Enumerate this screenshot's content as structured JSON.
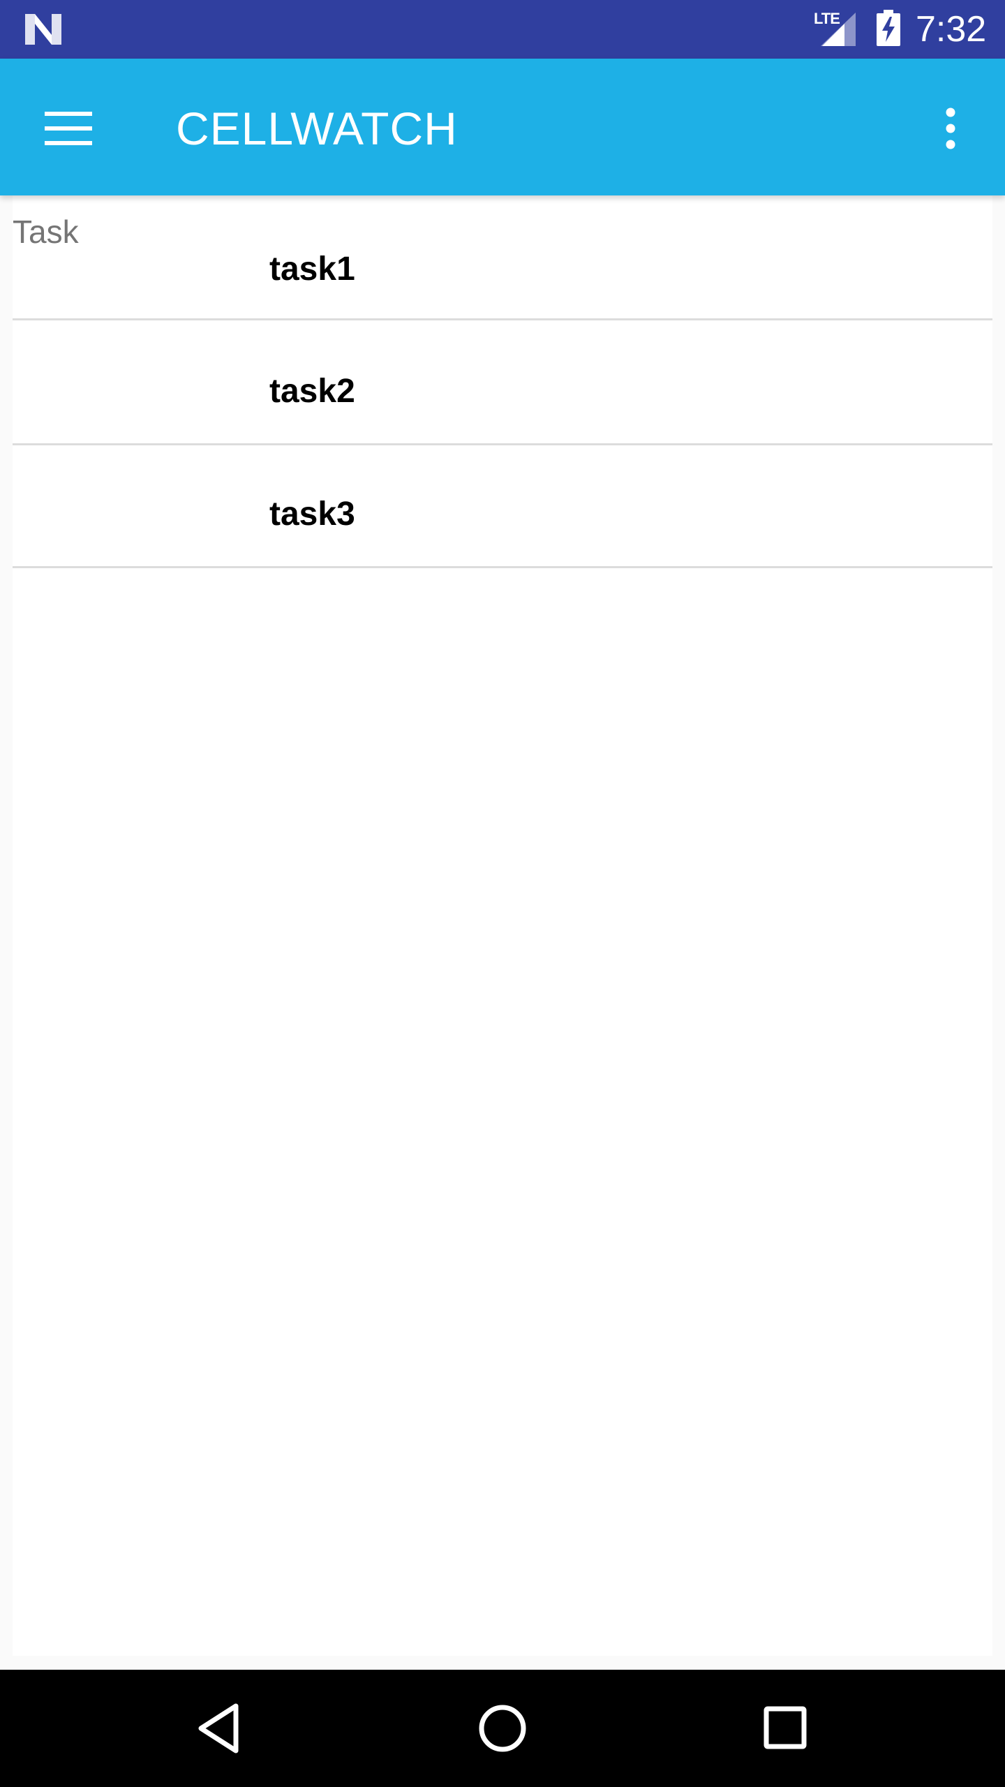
{
  "status_bar": {
    "network": "LTE",
    "time": "7:32",
    "icons": [
      "n-logo-icon",
      "signal-icon",
      "battery-charging-icon"
    ]
  },
  "app_bar": {
    "title": "CELLWATCH",
    "icons": [
      "menu-icon",
      "more-vert-icon"
    ]
  },
  "task_list": {
    "header": "Task",
    "items": [
      {
        "name": "task1"
      },
      {
        "name": "task2"
      },
      {
        "name": "task3"
      }
    ]
  },
  "nav_bar": {
    "icons": [
      "back-icon",
      "home-icon",
      "recents-icon"
    ]
  },
  "colors": {
    "status_bar": "#303f9f",
    "app_bar": "#1eb0e6",
    "background": "#fafafa",
    "divider": "#dcdcdc"
  }
}
